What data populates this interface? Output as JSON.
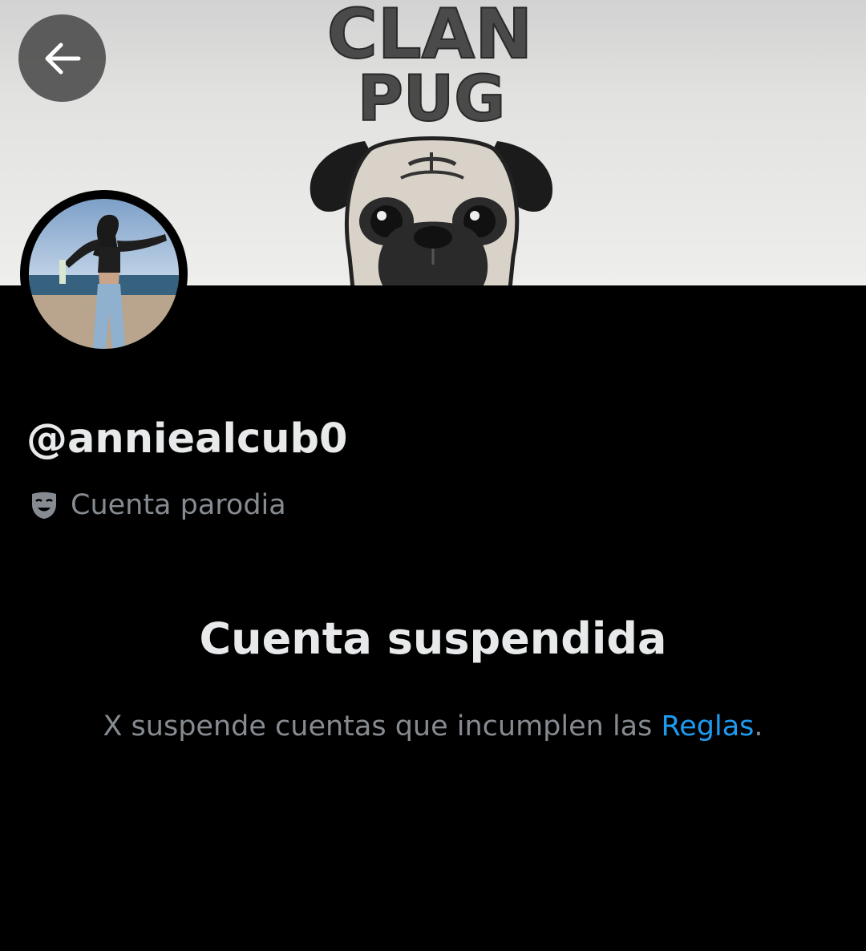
{
  "banner": {
    "text_line1": "CLAN",
    "text_line2": "PUG"
  },
  "header": {
    "back_icon": "arrow-left-icon"
  },
  "profile": {
    "handle": "@anniealcub0",
    "label_icon": "theater-mask-icon",
    "label": "Cuenta parodia"
  },
  "suspended": {
    "title": "Cuenta suspendida",
    "message_prefix": "X suspende cuentas que incumplen las ",
    "rules_link": "Reglas",
    "message_suffix": "."
  },
  "colors": {
    "background": "#000000",
    "primary_text": "#e7e9ea",
    "secondary_text": "#858b91",
    "link": "#1d9bf0"
  }
}
